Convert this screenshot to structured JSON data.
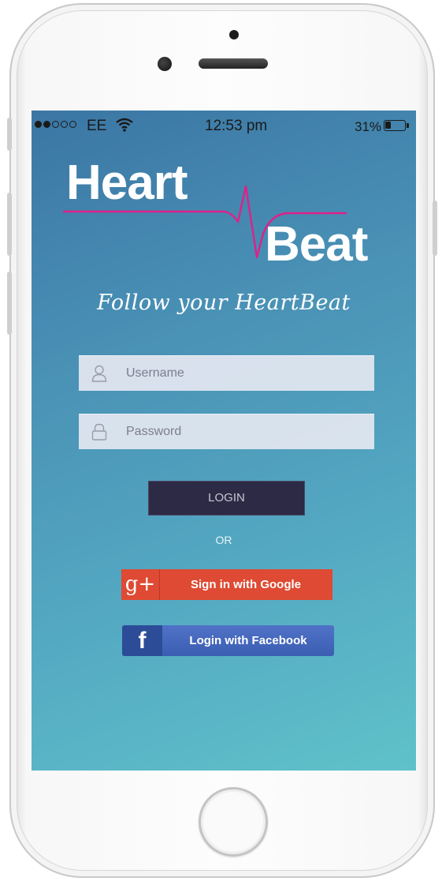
{
  "status_bar": {
    "signal_filled": 2,
    "signal_total": 5,
    "carrier": "EE",
    "time": "12:53 pm",
    "battery_text": "31%",
    "battery_level": 0.31
  },
  "logo": {
    "word1": "Heart",
    "word2": "Beat",
    "pulse_color": "#e0208a"
  },
  "tagline": "Follow your HeartBeat",
  "form": {
    "username_placeholder": "Username",
    "password_placeholder": "Password",
    "login_label": "LOGIN",
    "or_text": "OR"
  },
  "social": {
    "google_icon": "g+",
    "google_label": "Sign in with Google",
    "facebook_icon": "f",
    "facebook_label": "Login with Facebook"
  },
  "colors": {
    "google_red": "#de4a33",
    "facebook_blue": "#3b5db2",
    "login_button": "#2d2a45"
  }
}
